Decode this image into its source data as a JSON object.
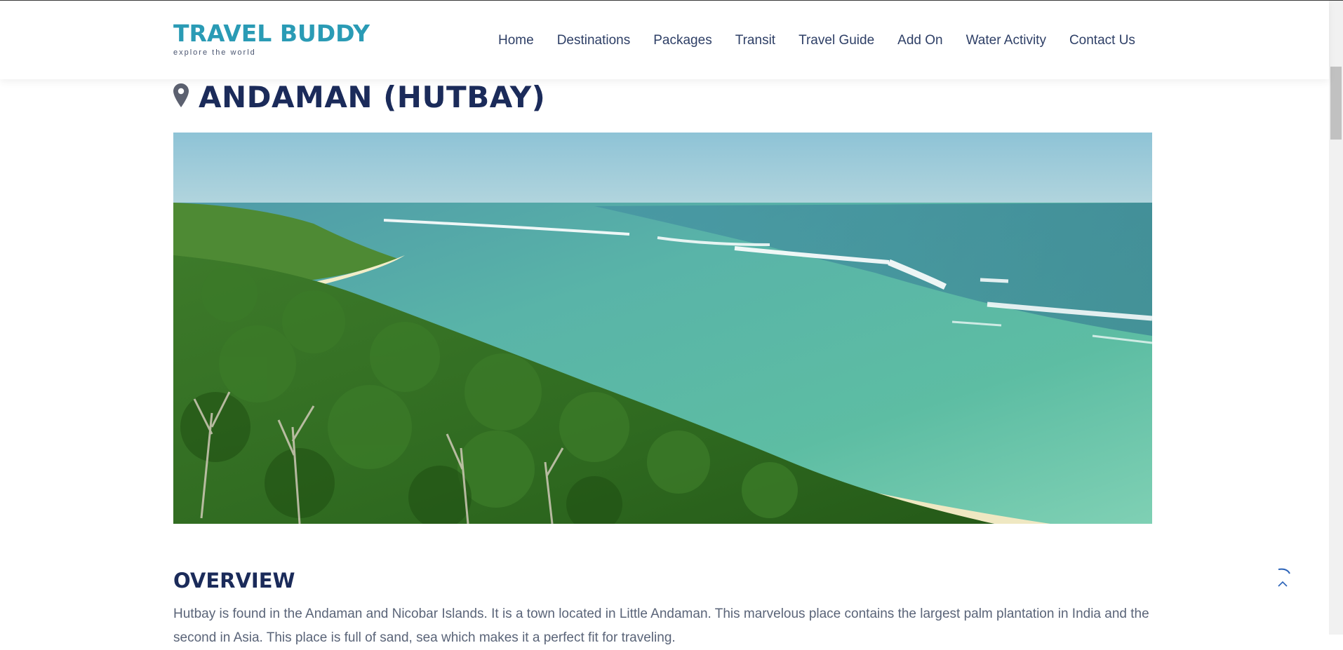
{
  "header": {
    "logo_title": "TRAVEL BUDDY",
    "logo_tagline": "explore the world",
    "nav": [
      "Home",
      "Destinations",
      "Packages",
      "Transit",
      "Travel Guide",
      "Add On",
      "Water Activity",
      "Contact Us"
    ]
  },
  "page": {
    "title": "ANDAMAN (HUTBAY)",
    "hero_image": "andaman-hutbay-coastline",
    "overview_heading": "OVERVIEW",
    "overview_text": "Hutbay is found in the Andaman and Nicobar Islands. It is a town located in Little Andaman. This marvelous place contains the largest palm plantation in India and the second in Asia. This place is full of sand, sea which makes it a perfect fit for traveling."
  },
  "icons": {
    "pin": "map-pin-icon",
    "back_to_top": "chevron-up-icon"
  },
  "colors": {
    "brand": "#2a9bb5",
    "heading": "#1b2b5a",
    "nav_text": "#2e3f66",
    "body_text": "#5a6478"
  }
}
